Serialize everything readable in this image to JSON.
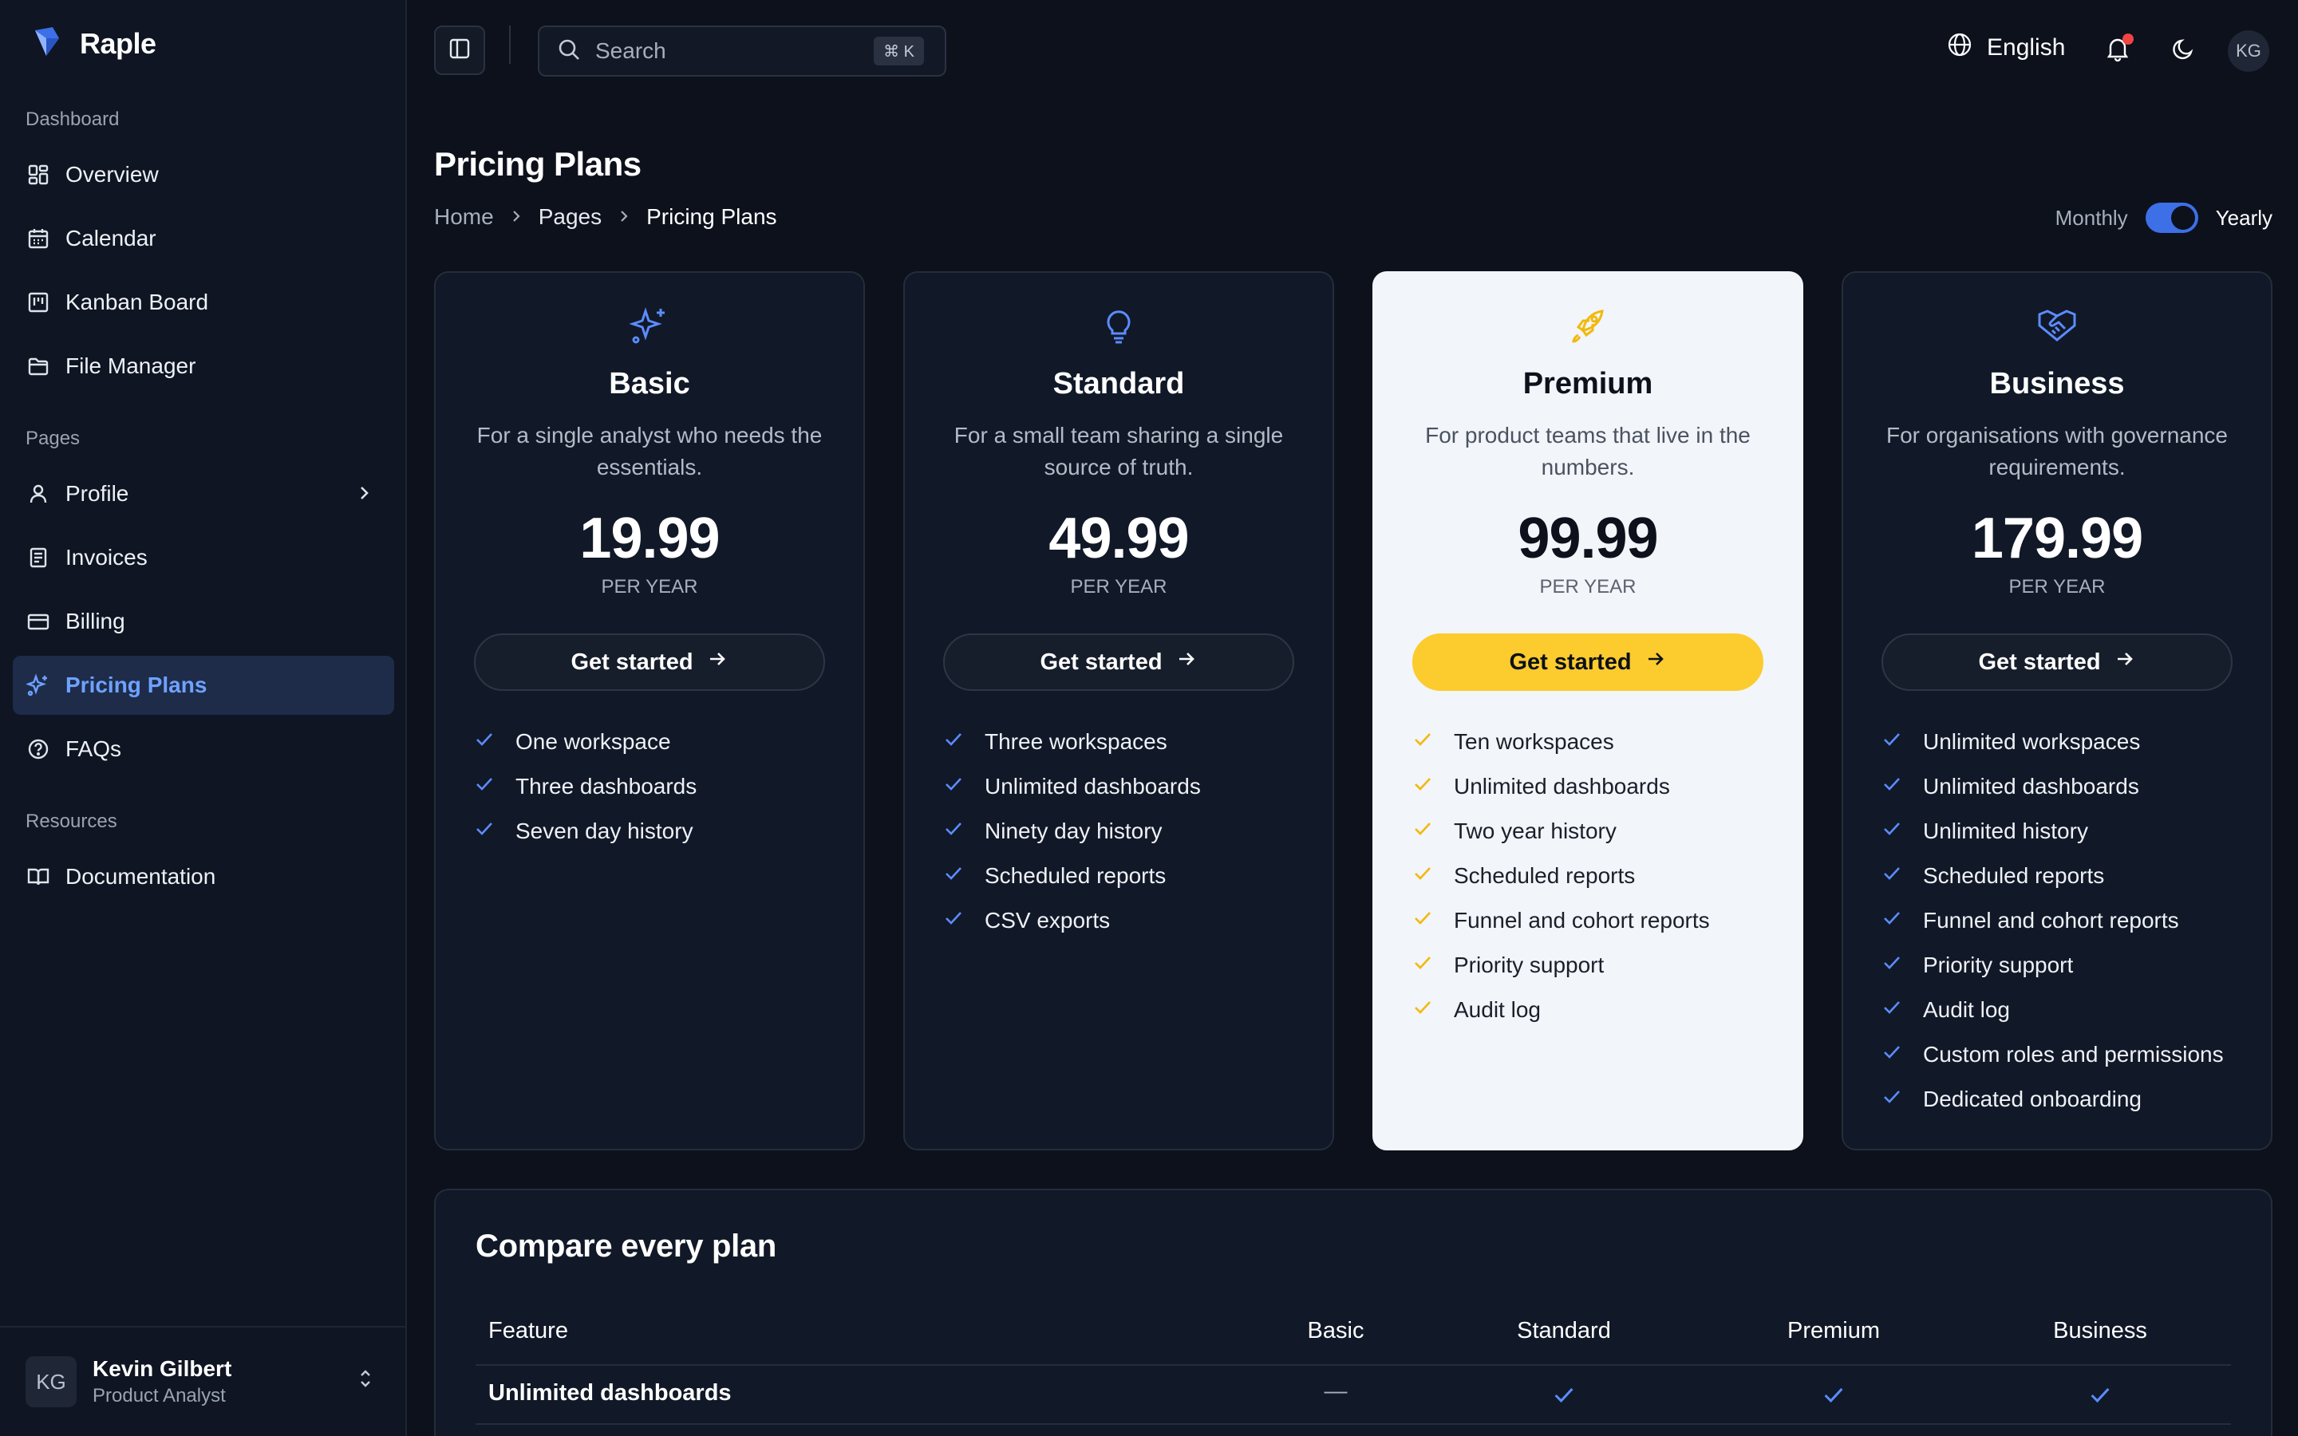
{
  "brand": {
    "name": "Raple"
  },
  "sidebar": {
    "sections": [
      {
        "title": "Dashboard",
        "items": [
          {
            "label": "Overview",
            "icon": "grid-icon"
          },
          {
            "label": "Calendar",
            "icon": "calendar-icon"
          },
          {
            "label": "Kanban Board",
            "icon": "kanban-icon"
          },
          {
            "label": "File Manager",
            "icon": "folder-icon"
          }
        ]
      },
      {
        "title": "Pages",
        "items": [
          {
            "label": "Profile",
            "icon": "user-icon"
          },
          {
            "label": "Invoices",
            "icon": "document-icon"
          },
          {
            "label": "Billing",
            "icon": "credit-card-icon"
          },
          {
            "label": "Pricing Plans",
            "icon": "sparkles-icon",
            "active": true
          },
          {
            "label": "FAQs",
            "icon": "help-circle-icon"
          }
        ]
      },
      {
        "title": "Resources",
        "items": [
          {
            "label": "Documentation",
            "icon": "book-icon"
          }
        ]
      }
    ],
    "user": {
      "initials": "KG",
      "name": "Kevin Gilbert",
      "role": "Product Analyst"
    }
  },
  "topbar": {
    "search_placeholder": "Search",
    "shortcut": "⌘ K",
    "language": "English",
    "avatar_initials": "KG"
  },
  "header": {
    "title": "Pricing Plans",
    "breadcrumb": [
      "Home",
      "Pages",
      "Pricing Plans"
    ],
    "toggle": {
      "left": "Monthly",
      "right": "Yearly",
      "state": "Yearly"
    }
  },
  "colors": {
    "accent": "#3d6fe6",
    "highlight": "#fccb2d",
    "background": "#0c111c",
    "card": "#111827"
  },
  "plans": [
    {
      "name": "Basic",
      "icon": "sparkles-icon",
      "description": "For a single analyst who needs the essentials.",
      "price": "19.99",
      "period": "PER YEAR",
      "cta": "Get started",
      "features": [
        "One workspace",
        "Three dashboards",
        "Seven day history"
      ]
    },
    {
      "name": "Standard",
      "icon": "lightbulb-icon",
      "description": "For a small team sharing a single source of truth.",
      "price": "49.99",
      "period": "PER YEAR",
      "cta": "Get started",
      "features": [
        "Three workspaces",
        "Unlimited dashboards",
        "Ninety day history",
        "Scheduled reports",
        "CSV exports"
      ]
    },
    {
      "name": "Premium",
      "icon": "rocket-icon",
      "highlighted": true,
      "description": "For product teams that live in the numbers.",
      "price": "99.99",
      "period": "PER YEAR",
      "cta": "Get started",
      "features": [
        "Ten workspaces",
        "Unlimited dashboards",
        "Two year history",
        "Scheduled reports",
        "Funnel and cohort reports",
        "Priority support",
        "Audit log"
      ]
    },
    {
      "name": "Business",
      "icon": "handshake-icon",
      "description": "For organisations with governance requirements.",
      "price": "179.99",
      "period": "PER YEAR",
      "cta": "Get started",
      "features": [
        "Unlimited workspaces",
        "Unlimited dashboards",
        "Unlimited history",
        "Scheduled reports",
        "Funnel and cohort reports",
        "Priority support",
        "Audit log",
        "Custom roles and permissions",
        "Dedicated onboarding"
      ]
    }
  ],
  "compare": {
    "title": "Compare every plan",
    "columns": [
      "Feature",
      "Basic",
      "Standard",
      "Premium",
      "Business"
    ],
    "rows": [
      {
        "feature": "Unlimited dashboards",
        "values": [
          "—",
          "check",
          "check",
          "check"
        ]
      }
    ]
  }
}
